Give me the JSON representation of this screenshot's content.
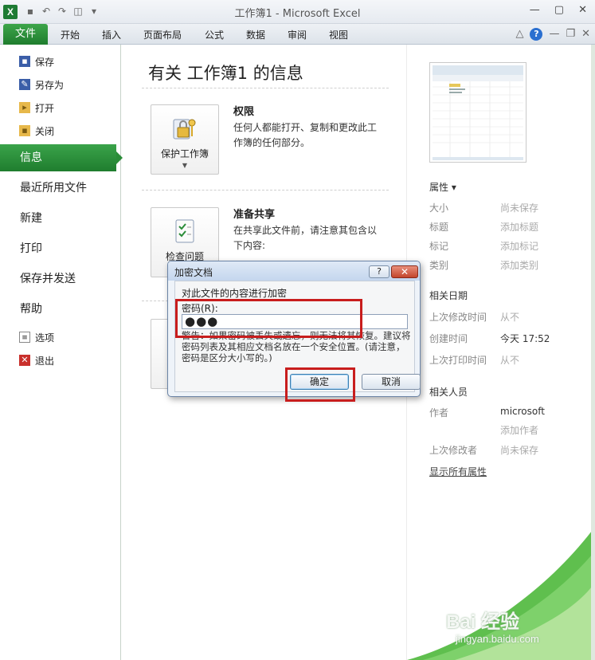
{
  "window": {
    "title": "工作簿1 - Microsoft Excel",
    "logo": "X"
  },
  "tabs": [
    "文件",
    "开始",
    "插入",
    "页面布局",
    "公式",
    "数据",
    "审阅",
    "视图"
  ],
  "nav": {
    "top_items": [
      "保存",
      "另存为",
      "打开",
      "关闭"
    ],
    "info": "信息",
    "big_items": [
      "最近所用文件",
      "新建",
      "打印",
      "保存并发送",
      "帮助"
    ],
    "bottom_items": [
      "选项",
      "退出"
    ]
  },
  "main": {
    "title": "有关 工作簿1 的信息",
    "permissions": {
      "button": "保护工作簿",
      "heading": "权限",
      "text": "任何人都能打开、复制和更改此工作簿的任何部分。"
    },
    "share": {
      "button": "检查问题",
      "heading": "准备共享",
      "text": "在共享此文件前，请注意其包含以下内容:"
    }
  },
  "properties": {
    "header": "属性 ▾",
    "rows": [
      {
        "label": "大小",
        "value": "尚未保存"
      },
      {
        "label": "标题",
        "value": "添加标题"
      },
      {
        "label": "标记",
        "value": "添加标记"
      },
      {
        "label": "类别",
        "value": "添加类别"
      }
    ],
    "dates_header": "相关日期",
    "dates": [
      {
        "label": "上次修改时间",
        "value": "从不"
      },
      {
        "label": "创建时间",
        "value": "今天 17:52"
      },
      {
        "label": "上次打印时间",
        "value": "从不"
      }
    ],
    "people_header": "相关人员",
    "author_label": "作者",
    "author_value": "microsoft",
    "add_author": "添加作者",
    "modified_by_label": "上次修改者",
    "modified_by_value": "尚未保存",
    "show_all": "显示所有属性"
  },
  "dialog": {
    "title": "加密文档",
    "help": "?",
    "close": "✕",
    "intro": "对此文件的内容进行加密",
    "password_label": "密码(R):",
    "password_value": "●●●",
    "warning": "警告：如果密码被丢失或遗忘，则无法将其恢复。建议将密码列表及其相应文档名放在一个安全位置。(请注意，密码是区分大小写的。)",
    "ok": "确定",
    "cancel": "取消"
  },
  "watermark": {
    "brand": "Bai 经验",
    "url": "jingyan.baidu.com"
  },
  "colors": {
    "accent_green": "#2a8c38",
    "highlight_red": "#c81d1d"
  }
}
